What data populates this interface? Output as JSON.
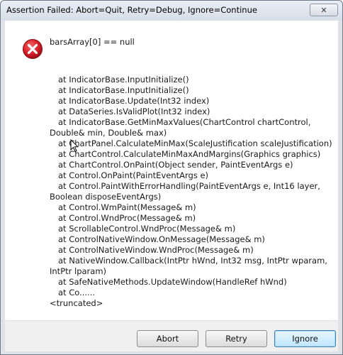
{
  "window": {
    "title": "Assertion Failed: Abort=Quit, Retry=Debug, Ignore=Continue",
    "close_label": "✕"
  },
  "icons": {
    "error": "error-icon",
    "close": "close-icon",
    "cursor": "mouse-cursor-icon"
  },
  "colors": {
    "error_red": "#d9212a",
    "default_button_border": "#3c7fb1"
  },
  "message": {
    "assertion": "barsArray[0] == null",
    "stack": [
      {
        "text": "at IndicatorBase.InputInitialize()",
        "indent": true
      },
      {
        "text": "at IndicatorBase.InputInitialize()",
        "indent": true
      },
      {
        "text": "at IndicatorBase.Update(Int32 index)",
        "indent": true
      },
      {
        "text": "at DataSeries.IsValidPlot(Int32 index)",
        "indent": true
      },
      {
        "text": "at IndicatorBase.GetMinMaxValues(ChartControl chartControl,",
        "indent": true
      },
      {
        "text": "Double& min, Double& max)",
        "indent": false
      },
      {
        "text": "at ChartPanel.CalculateMinMax(ScaleJustification scaleJustification)",
        "indent": true
      },
      {
        "text": "at ChartControl.CalculateMinMaxAndMargins(Graphics graphics)",
        "indent": true
      },
      {
        "text": "at ChartControl.OnPaint(Object sender, PaintEventArgs e)",
        "indent": true
      },
      {
        "text": "at Control.OnPaint(PaintEventArgs e)",
        "indent": true
      },
      {
        "text": "at Control.PaintWithErrorHandling(PaintEventArgs e, Int16 layer,",
        "indent": true
      },
      {
        "text": "Boolean disposeEventArgs)",
        "indent": false
      },
      {
        "text": "at Control.WmPaint(Message& m)",
        "indent": true
      },
      {
        "text": "at Control.WndProc(Message& m)",
        "indent": true
      },
      {
        "text": "at ScrollableControl.WndProc(Message& m)",
        "indent": true
      },
      {
        "text": "at ControlNativeWindow.OnMessage(Message& m)",
        "indent": true
      },
      {
        "text": "at ControlNativeWindow.WndProc(Message& m)",
        "indent": true
      },
      {
        "text": "at NativeWindow.Callback(IntPtr hWnd, Int32 msg, IntPtr wparam,",
        "indent": true
      },
      {
        "text": "IntPtr lparam)",
        "indent": false
      },
      {
        "text": "at SafeNativeMethods.UpdateWindow(HandleRef hWnd)",
        "indent": true
      },
      {
        "text": "at Co......",
        "indent": true
      },
      {
        "text": "<truncated>",
        "indent": false
      }
    ]
  },
  "buttons": {
    "abort": "Abort",
    "retry": "Retry",
    "ignore": "Ignore"
  }
}
